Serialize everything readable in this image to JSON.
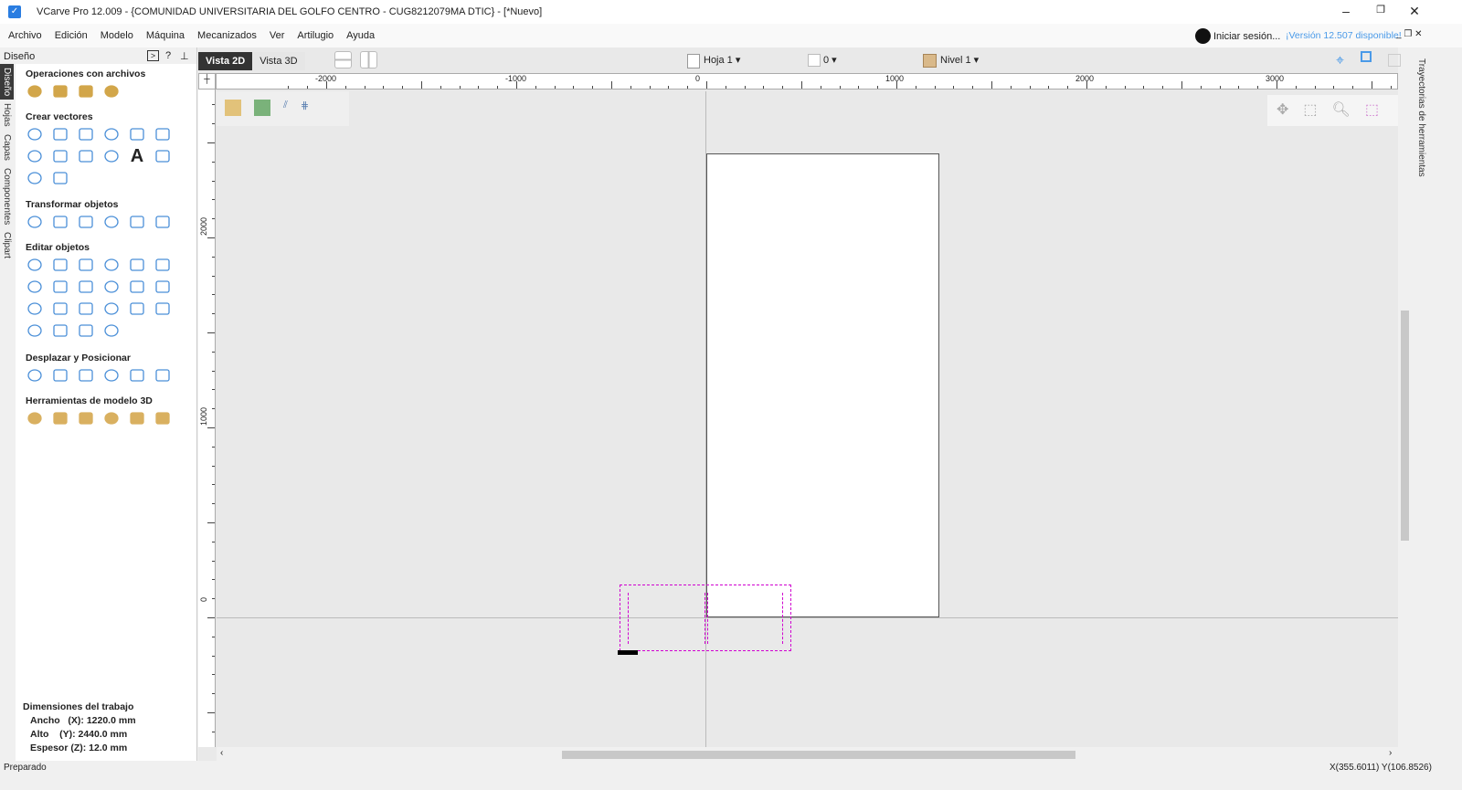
{
  "window": {
    "title": "VCarve Pro 12.009 - {COMUNIDAD UNIVERSITARIA DEL GOLFO CENTRO - CUG8212079MA DTIC} - [*Nuevo]",
    "minimize": "–",
    "maximize": "❐",
    "close": "✕"
  },
  "menu": [
    "Archivo",
    "Edición",
    "Modelo",
    "Máquina",
    "Mecanizados",
    "Ver",
    "Artilugio",
    "Ayuda"
  ],
  "account": {
    "signin": "Iniciar sesión...",
    "update": "¡Versión 12.507 disponible!"
  },
  "sidebar": {
    "title": "Diseño",
    "help": "?",
    "pin": "⊥",
    "vtabs": [
      "Diseño",
      "Hojas",
      "Capas",
      "Componentes",
      "Clipart"
    ],
    "sections": [
      {
        "title": "Operaciones con archivos",
        "icons": [
          "new-file-icon",
          "open-file-icon",
          "import-icon",
          "import-component-icon"
        ]
      },
      {
        "title": "Crear vectores",
        "icons": [
          "circle-icon",
          "ellipse-icon",
          "rectangle-icon",
          "polygon-icon",
          "star-icon",
          "polyline-icon",
          "arc-icon",
          "curve-icon",
          "fill-icon",
          "drawing-icon",
          "text-icon",
          "auto-text-icon",
          "text-on-curve-icon",
          "trace-bitmap-icon"
        ]
      },
      {
        "title": "Transformar objetos",
        "icons": [
          "move-icon",
          "scale-icon",
          "align-icon",
          "mirror-icon",
          "distort-icon",
          "size-icon"
        ]
      },
      {
        "title": "Editar objetos",
        "icons": [
          "select-icon",
          "node-edit-icon",
          "transform-icon",
          "group-select-icon",
          "join-icon",
          "measure-icon",
          "weld-icon",
          "subtract-icon",
          "intersect-icon",
          "trim-icon",
          "scissors-icon",
          "validate-icon",
          "fillet-icon",
          "chamfer-icon",
          "smooth-icon",
          "offset-icon",
          "layer-icon",
          "bitmap-icon",
          "rounded-rect-icon",
          "extend-icon",
          "arc-extend-icon",
          "angle-icon"
        ]
      },
      {
        "title": "Desplazar y Posicionar",
        "icons": [
          "border-icon",
          "array-icon",
          "copy-along-icon",
          "path-icon",
          "nest-icon",
          "label-icon"
        ]
      },
      {
        "title": "Herramientas de modelo 3D",
        "icons": [
          "model-3d-icon",
          "component-3d-icon",
          "cylinder-icon",
          "layer-3d-icon",
          "dome-icon",
          "plane-icon"
        ]
      }
    ],
    "job": {
      "title": "Dimensiones del trabajo",
      "width": "Ancho   (X): 1220.0 mm",
      "height": "Alto    (Y): 2440.0 mm",
      "thickness": "Espesor (Z): 12.0 mm"
    }
  },
  "view": {
    "tab2d": "Vista 2D",
    "tab3d": "Vista 3D",
    "sheet": "Hoja 1 ▾",
    "counter": "0 ▾",
    "level": "Nivel 1 ▾"
  },
  "ruler": {
    "h": [
      "-2000",
      "-1000",
      "0",
      "1000",
      "2000",
      "3000"
    ],
    "v": [
      "2000",
      "1000",
      "0"
    ]
  },
  "right_tab": "Trayectorias de herramientas",
  "status": {
    "left": "Preparado",
    "coords": "X(355.6011) Y(106.8526)"
  },
  "colors": {
    "accent": "#2a7de1",
    "select": "#d000d0"
  }
}
